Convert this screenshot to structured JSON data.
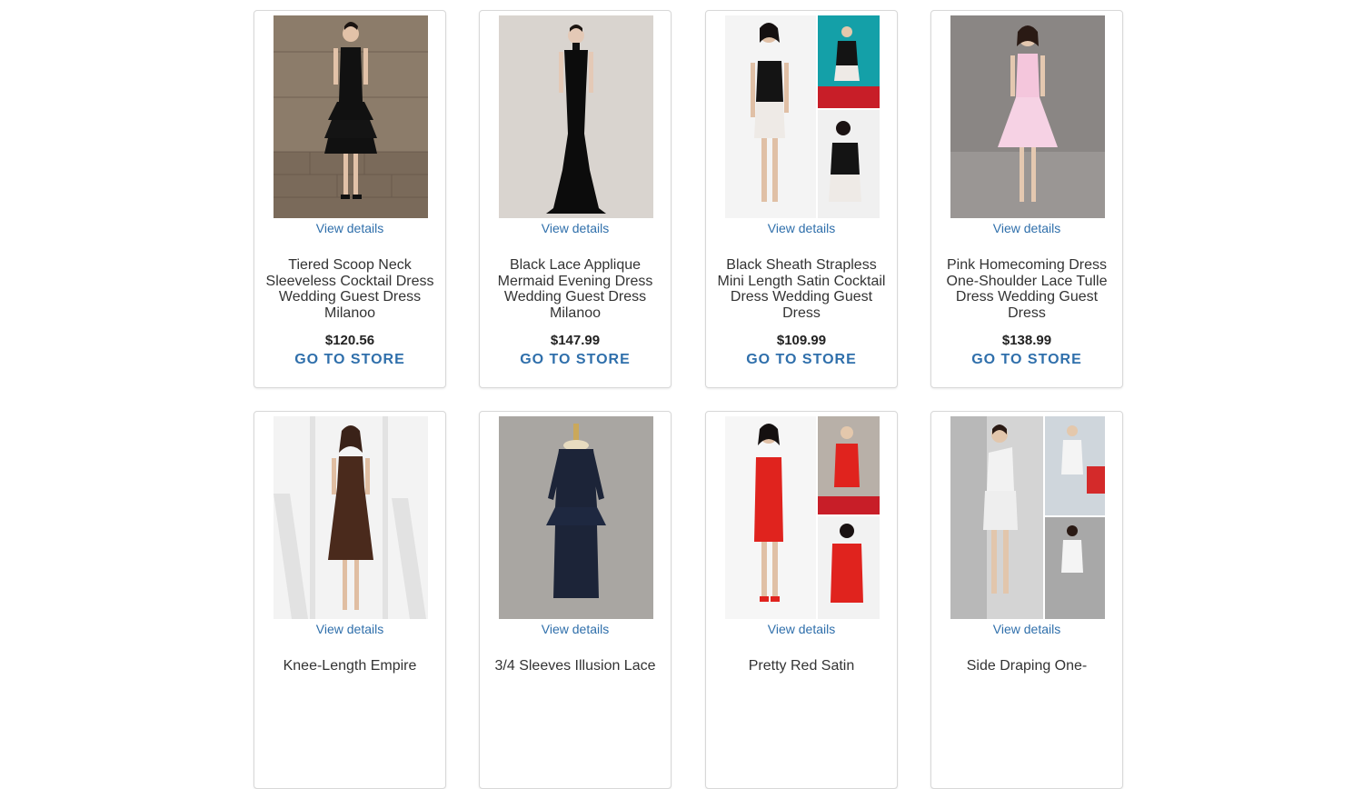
{
  "products": [
    {
      "view_label": "View details",
      "title": "Tiered Scoop Neck Sleeveless Cocktail Dress Wedding Guest Dress Milanoo",
      "price": "$120.56",
      "cta": "GO TO STORE",
      "dress_color": "#111111",
      "bg_color": "#7a6a5a",
      "image_icon": "black-tiered-cocktail-dress-photo"
    },
    {
      "view_label": "View details",
      "title": "Black Lace Applique Mermaid Evening Dress Wedding Guest Dress Milanoo",
      "price": "$147.99",
      "cta": "GO TO STORE",
      "dress_color": "#0c0c0c",
      "bg_color": "#d9d4cf",
      "image_icon": "black-mermaid-gown-photo"
    },
    {
      "view_label": "View details",
      "title": "Black Sheath Strapless Mini Length Satin Cocktail Dress Wedding Guest Dress",
      "price": "$109.99",
      "cta": "GO TO STORE",
      "dress_color": "#141414",
      "bg_color": "#f2f2f2",
      "image_icon": "black-strapless-mini-dress-photo"
    },
    {
      "view_label": "View details",
      "title": "Pink Homecoming Dress One-Shoulder Lace Tulle Dress Wedding Guest Dress",
      "price": "$138.99",
      "cta": "GO TO STORE",
      "dress_color": "#f4c6dc",
      "bg_color": "#8a8684",
      "image_icon": "pink-tulle-dress-photo"
    },
    {
      "view_label": "View details",
      "title": "Knee-Length Empire",
      "price": "",
      "cta": "",
      "dress_color": "#4a2a1c",
      "bg_color": "#f0f0f0",
      "image_icon": "brown-empire-dress-photo"
    },
    {
      "view_label": "View details",
      "title": "3/4 Sleeves Illusion Lace",
      "price": "",
      "cta": "",
      "dress_color": "#1c2438",
      "bg_color": "#a9a6a2",
      "image_icon": "navy-lace-peplum-dress-photo"
    },
    {
      "view_label": "View details",
      "title": "Pretty Red Satin",
      "price": "",
      "cta": "",
      "dress_color": "#e0231e",
      "bg_color": "#f5f5f5",
      "image_icon": "red-satin-dress-photo"
    },
    {
      "view_label": "View details",
      "title": "Side Draping One-",
      "price": "",
      "cta": "",
      "dress_color": "#f2f2f2",
      "bg_color": "#8e8e8e",
      "image_icon": "white-draped-dress-photo"
    }
  ]
}
